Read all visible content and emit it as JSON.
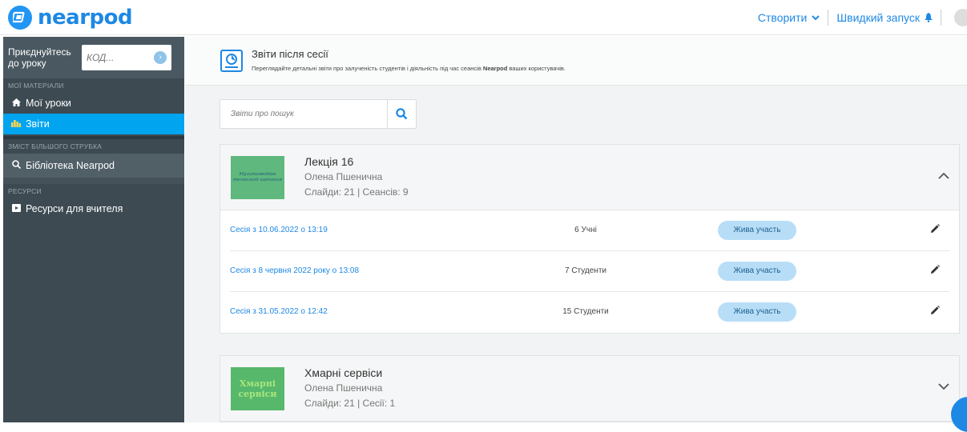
{
  "app": {
    "logo_text": "nearpod",
    "create_label": "Створити",
    "quick_launch_label": "Швидкий запуск"
  },
  "sidebar": {
    "join_label": "Приєднуйтесь до уроку",
    "code_placeholder": "КОД...",
    "sections": [
      {
        "title": "МОЇ МАТЕРІАЛИ",
        "items": [
          {
            "label": "Мої уроки"
          },
          {
            "label": "Звіти"
          }
        ]
      },
      {
        "title": "ЗМІСТ БІЛЬШОГО СТРУБКА",
        "items": [
          {
            "label": "Бібліотека Nearpod"
          }
        ]
      },
      {
        "title": "РЕСУРСИ",
        "items": [
          {
            "label": "Ресурси для вчителя"
          }
        ]
      }
    ]
  },
  "header": {
    "title": "Звіти після сесії",
    "subtitle_pre": "Переглядайте детальні звіти про залученість студентів і діяльність під час сеансів ",
    "subtitle_brand": "Nearpod",
    "subtitle_post": " ваших користувачів."
  },
  "search": {
    "placeholder": "Звіти про пошук"
  },
  "lessons": [
    {
      "title": "Лекція 16",
      "author": "Олена Пшенична",
      "meta": "Слайди: 21 | Сеансів: 9",
      "thumb_text": "Мультимедійні технології навчання",
      "sessions": [
        {
          "date": "Сесія з 10.06.2022 о 13:19",
          "count": "6 Учні",
          "badge": "Жива участь"
        },
        {
          "date": "Сесія з 8 червня 2022 року о 13:08",
          "count": "7 Студенти",
          "badge": "Жива участь"
        },
        {
          "date": "Сесія з 31.05.2022 о 12:42",
          "count": "15 Студенти",
          "badge": "Жива участь"
        }
      ]
    },
    {
      "title": "Хмарні сервіси",
      "author": "Олена Пшенична",
      "meta": "Слайди: 21 | Сесії: 1",
      "thumb_text": "Хмарні сервіси"
    }
  ],
  "colors": {
    "accent": "#1e88e5",
    "sidebar": "#3d4a52",
    "active": "#00a4ef",
    "badge": "#b8def7"
  }
}
